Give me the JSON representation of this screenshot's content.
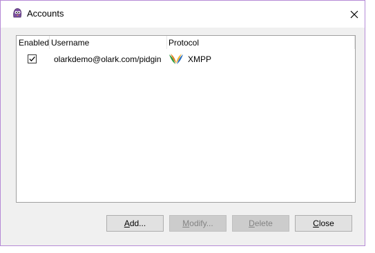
{
  "window": {
    "title": "Accounts",
    "app_icon": "pidgin-icon",
    "close_icon": "close-icon"
  },
  "accounts_list": {
    "columns": [
      "Enabled",
      "Username",
      "Protocol"
    ],
    "rows": [
      {
        "enabled": true,
        "username": "olarkdemo@olark.com/pidgin",
        "protocol": "XMPP",
        "protocol_icon": "xmpp-icon"
      }
    ]
  },
  "buttons": {
    "add": {
      "first": "A",
      "rest": "dd...",
      "enabled": true
    },
    "modify": {
      "first": "M",
      "rest": "odify...",
      "enabled": false
    },
    "delete": {
      "first": "D",
      "rest": "elete",
      "enabled": false
    },
    "close": {
      "first": "C",
      "rest": "lose",
      "enabled": true
    }
  },
  "colors": {
    "window_border": "#b58ad6",
    "dialog_bg": "#f0f0f0",
    "disabled_text": "#838383"
  }
}
